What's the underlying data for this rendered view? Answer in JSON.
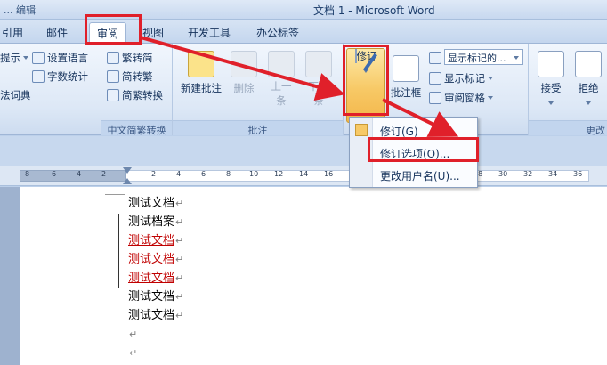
{
  "window": {
    "title": "文档 1 - Microsoft Word",
    "left_fragment": "... 编辑"
  },
  "tabs": [
    {
      "label": "引用"
    },
    {
      "label": "邮件"
    },
    {
      "label": "审阅"
    },
    {
      "label": "视图"
    },
    {
      "label": "开发工具"
    },
    {
      "label": "办公标签"
    }
  ],
  "ribbon": {
    "proofing": {
      "items": [
        "提示",
        "法词典",
        "设置语言",
        "字数统计"
      ]
    },
    "chinese_conversion": {
      "label": "中文简繁转换",
      "items": [
        "繁转简",
        "简转繁",
        "简繁转换"
      ]
    },
    "comments": {
      "label": "批注",
      "new_comment": "新建批注",
      "delete": "删除",
      "prev_1": "上一",
      "prev_2": "条",
      "next_1": "下一",
      "next_2": "条"
    },
    "tracking": {
      "track_changes": "修订",
      "balloons": "批注框",
      "show_markup_combo": "显示标记的...",
      "show_markup": "显示标记",
      "reviewing_pane": "审阅窗格"
    },
    "changes": {
      "label": "更改",
      "accept": "接受",
      "reject": "拒绝"
    }
  },
  "menu": {
    "items": [
      "修订(G)",
      "修订选项(O)...",
      "更改用户名(U)..."
    ]
  },
  "ruler": {
    "ticks": [
      "8",
      "6",
      "4",
      "2",
      "2",
      "4",
      "6",
      "8",
      "10",
      "12",
      "14",
      "16",
      "18",
      "20",
      "22",
      "24",
      "26",
      "28",
      "30",
      "32",
      "34",
      "36"
    ]
  },
  "document": {
    "lines": [
      {
        "text": "测试文档",
        "revised": false
      },
      {
        "text": "测试档案",
        "revised": false
      },
      {
        "text": "测试文档",
        "revised": true
      },
      {
        "text": "测试文档",
        "revised": true
      },
      {
        "text": "测试文档",
        "revised": true
      },
      {
        "text": "测试文档",
        "revised": false
      },
      {
        "text": "测试文档",
        "revised": false
      },
      {
        "text": "",
        "revised": false
      },
      {
        "text": "",
        "revised": false
      }
    ],
    "paragraph_mark": "↵"
  },
  "colors": {
    "highlight": "#e0202a",
    "revision_text": "#c00000",
    "track_button": "#f7c966"
  }
}
